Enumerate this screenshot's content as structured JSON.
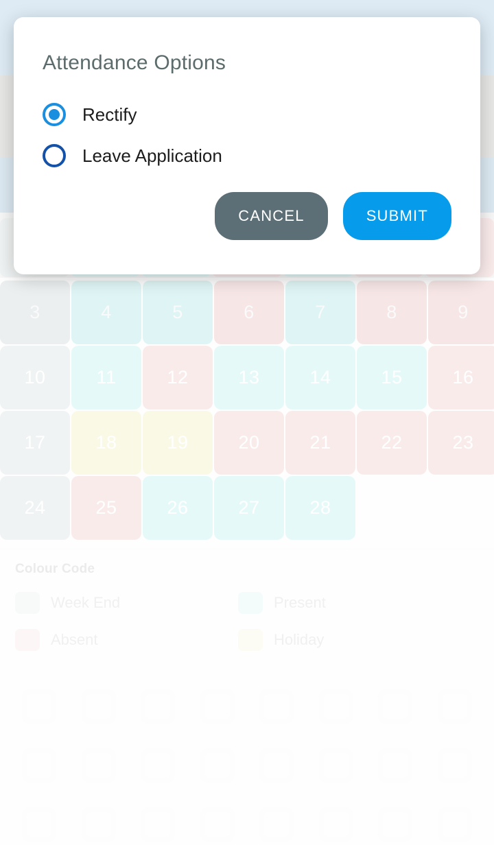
{
  "dialog": {
    "title": "Attendance Options",
    "options": [
      {
        "label": "Rectify",
        "selected": true
      },
      {
        "label": "Leave Application",
        "selected": false
      }
    ],
    "cancel_label": "CANCEL",
    "submit_label": "SUBMIT",
    "accent_selected_color": "#1a8fe0",
    "accent_unselected_color": "#1352a8",
    "cancel_color": "#5c6e76",
    "submit_color": "#069ceb",
    "title_color": "#5c6b6b"
  },
  "calendar": {
    "colors": {
      "weekend": "#dde5e5",
      "present": "#c8f1f1",
      "absent": "#f4d3d3",
      "holiday": "#f4f2c8"
    },
    "rows": [
      [
        {
          "day": "3",
          "status": "weekend"
        },
        {
          "day": "4",
          "status": "present"
        },
        {
          "day": "5",
          "status": "present"
        },
        {
          "day": "6",
          "status": "absent"
        },
        {
          "day": "7",
          "status": "present"
        },
        {
          "day": "8",
          "status": "absent"
        },
        {
          "day": "9",
          "status": "absent"
        }
      ],
      [
        {
          "day": "10",
          "status": "weekend"
        },
        {
          "day": "11",
          "status": "present"
        },
        {
          "day": "12",
          "status": "absent"
        },
        {
          "day": "13",
          "status": "present"
        },
        {
          "day": "14",
          "status": "present"
        },
        {
          "day": "15",
          "status": "present"
        },
        {
          "day": "16",
          "status": "absent"
        }
      ],
      [
        {
          "day": "17",
          "status": "weekend"
        },
        {
          "day": "18",
          "status": "holiday"
        },
        {
          "day": "19",
          "status": "holiday"
        },
        {
          "day": "20",
          "status": "absent"
        },
        {
          "day": "21",
          "status": "absent"
        },
        {
          "day": "22",
          "status": "absent"
        },
        {
          "day": "23",
          "status": "absent"
        }
      ],
      [
        {
          "day": "24",
          "status": "weekend"
        },
        {
          "day": "25",
          "status": "absent"
        },
        {
          "day": "26",
          "status": "present"
        },
        {
          "day": "27",
          "status": "present"
        },
        {
          "day": "28",
          "status": "present"
        },
        {
          "day": "",
          "status": "empty"
        },
        {
          "day": "",
          "status": "empty"
        }
      ]
    ],
    "peek_row": [
      "weekend",
      "present",
      "present",
      "absent",
      "present",
      "absent",
      "absent"
    ]
  },
  "legend": {
    "title": "Colour Code",
    "items": [
      {
        "label": "Week End",
        "color": "#dde5e5"
      },
      {
        "label": "Present",
        "color": "#c8f1f1"
      },
      {
        "label": "Absent",
        "color": "#f4d3d3"
      },
      {
        "label": "Holiday",
        "color": "#f4f2c8"
      }
    ]
  },
  "icon_tray": {
    "items": [
      {
        "icon": "attendance-icon",
        "label": ""
      },
      {
        "icon": "calendar-icon",
        "label": ""
      },
      {
        "icon": "document-icon",
        "label": ""
      },
      {
        "icon": "settings-icon",
        "label": ""
      },
      {
        "icon": "person-icon",
        "label": ""
      },
      {
        "icon": "notice-icon",
        "label": ""
      },
      {
        "icon": "chart-icon",
        "label": ""
      },
      {
        "icon": "group-icon",
        "label": ""
      },
      {
        "icon": "hand-icon",
        "label": ""
      },
      {
        "icon": "book-icon",
        "label": ""
      },
      {
        "icon": "note-icon",
        "label": ""
      },
      {
        "icon": "thumb-icon",
        "label": ""
      },
      {
        "icon": "link-icon",
        "label": ""
      },
      {
        "icon": "building-icon",
        "label": ""
      },
      {
        "icon": "badge-icon",
        "label": ""
      },
      {
        "icon": "clipboard-icon",
        "label": ""
      },
      {
        "icon": "library-icon",
        "label": ""
      },
      {
        "icon": "archive-icon",
        "label": ""
      },
      {
        "icon": "bottle-icon",
        "label": ""
      },
      {
        "icon": "box-icon",
        "label": ""
      },
      {
        "icon": "bell-icon",
        "label": ""
      },
      {
        "icon": "device-icon",
        "label": ""
      },
      {
        "icon": "pin-icon",
        "label": ""
      },
      {
        "icon": "folder-icon",
        "label": ""
      }
    ]
  }
}
